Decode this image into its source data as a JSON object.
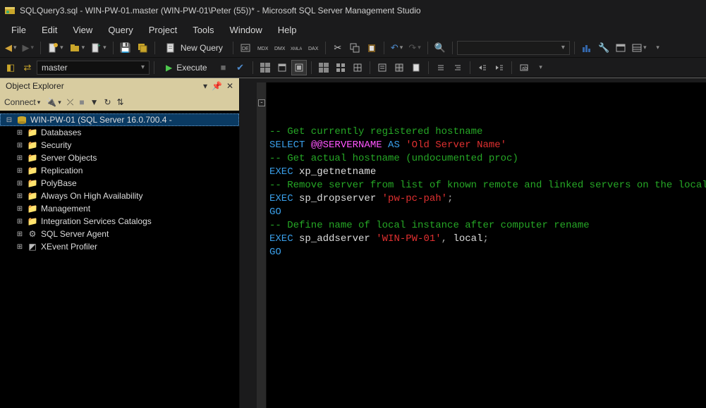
{
  "window": {
    "title": "SQLQuery3.sql - WIN-PW-01.master (WIN-PW-01\\Peter (55))* - Microsoft SQL Server Management Studio"
  },
  "menu": {
    "items": [
      "File",
      "Edit",
      "View",
      "Query",
      "Project",
      "Tools",
      "Window",
      "Help"
    ]
  },
  "toolbar1": {
    "new_query": "New Query"
  },
  "toolbar2": {
    "database": "master",
    "execute": "Execute"
  },
  "object_explorer": {
    "title": "Object Explorer",
    "connect_label": "Connect",
    "server_label": "WIN-PW-01 (SQL Server 16.0.700.4 -",
    "nodes": [
      "Databases",
      "Security",
      "Server Objects",
      "Replication",
      "PolyBase",
      "Always On High Availability",
      "Management",
      "Integration Services Catalogs",
      "SQL Server Agent",
      "XEvent Profiler"
    ]
  },
  "sql": {
    "l1_comment": "-- Get currently registered hostname",
    "l2_select": "SELECT",
    "l2_srv": " @@SERVERNAME ",
    "l2_as": "AS",
    "l2_str": " 'Old Server Name'",
    "l3_comment": "-- Get actual hostname (undocumented proc)",
    "l4_exec": "EXEC",
    "l4_proc": " xp_getnetname",
    "blank1": "",
    "l6_comment": "-- Remove server from list of known remote and linked servers on the local instance",
    "l7_exec": "EXEC",
    "l7_proc": " sp_dropserver ",
    "l7_str": "'pw-pc-pah'",
    "l7_semi": ";",
    "l8_go": "GO",
    "l9_comment": "-- Define name of local instance after computer rename",
    "l10_exec": "EXEC",
    "l10_proc": " sp_addserver ",
    "l10_str": "'WIN-PW-01'",
    "l10_comma": ", ",
    "l10_local": "local",
    "l10_semi": ";",
    "l11_go": "GO"
  }
}
